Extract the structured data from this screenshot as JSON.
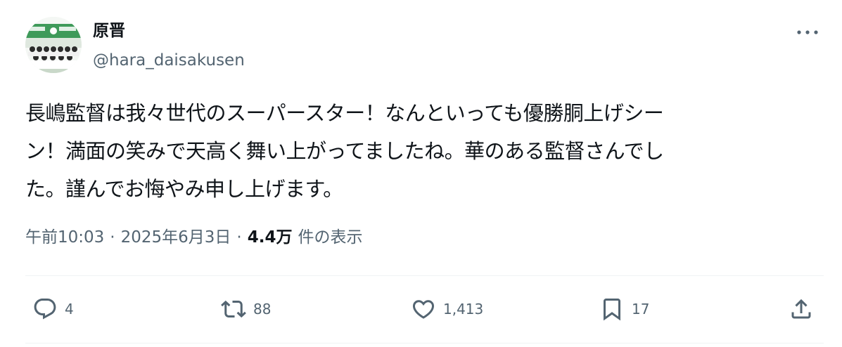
{
  "user": {
    "display_name": "原晋",
    "handle": "@hara_daisakusen",
    "avatar_icon": "group-photo-avatar"
  },
  "tweet": {
    "lines": [
      "長嶋監督は我々世代のスーパースター！なんといっても優勝胴上げシー",
      "ン！満面の笑みで天高く舞い上がってましたね。華のある監督さんでし",
      "た。謹んでお悔やみ申し上げます。"
    ]
  },
  "meta": {
    "time": "午前10:03",
    "separator": "·",
    "date": "2025年6月3日",
    "views_count": "4.4万",
    "views_label": "件の表示"
  },
  "actions": {
    "replies": "4",
    "reposts": "88",
    "likes": "1,413",
    "bookmarks": "17"
  },
  "colors": {
    "text": "#0f1419",
    "secondary": "#536471",
    "divider": "#eff3f4"
  }
}
